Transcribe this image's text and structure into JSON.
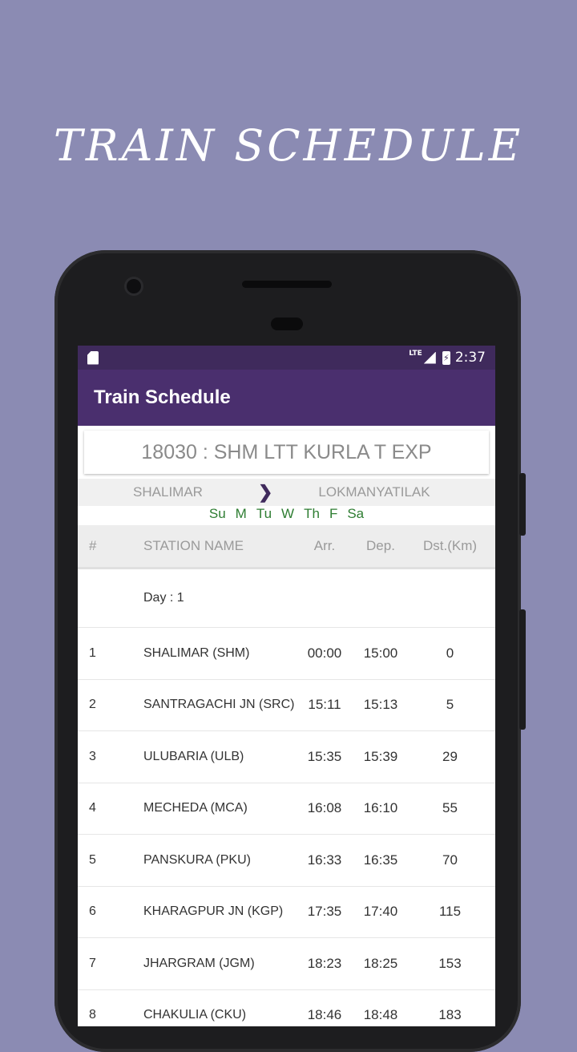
{
  "promo": {
    "title": "TRAIN SCHEDULE"
  },
  "status_bar": {
    "lte": "LTE",
    "time": "2:37"
  },
  "app_bar": {
    "title": "Train Schedule"
  },
  "train": {
    "name": "18030 : SHM LTT KURLA T EXP",
    "from": "SHALIMAR",
    "to": "LOKMANYATILAK",
    "days": [
      "Su",
      "M",
      "Tu",
      "W",
      "Th",
      "F",
      "Sa"
    ]
  },
  "table": {
    "headers": {
      "num": "#",
      "station": "STATION NAME",
      "arr": "Arr.",
      "dep": "Dep.",
      "dst": "Dst.(Km)"
    },
    "day_label": "Day : 1",
    "rows": [
      {
        "num": "1",
        "station": "SHALIMAR (SHM)",
        "arr": "00:00",
        "dep": "15:00",
        "dst": "0"
      },
      {
        "num": "2",
        "station": "SANTRAGACHI JN (SRC)",
        "arr": "15:11",
        "dep": "15:13",
        "dst": "5"
      },
      {
        "num": "3",
        "station": "ULUBARIA (ULB)",
        "arr": "15:35",
        "dep": "15:39",
        "dst": "29"
      },
      {
        "num": "4",
        "station": "MECHEDA (MCA)",
        "arr": "16:08",
        "dep": "16:10",
        "dst": "55"
      },
      {
        "num": "5",
        "station": "PANSKURA (PKU)",
        "arr": "16:33",
        "dep": "16:35",
        "dst": "70"
      },
      {
        "num": "6",
        "station": "KHARAGPUR JN (KGP)",
        "arr": "17:35",
        "dep": "17:40",
        "dst": "115"
      },
      {
        "num": "7",
        "station": "JHARGRAM (JGM)",
        "arr": "18:23",
        "dep": "18:25",
        "dst": "153"
      },
      {
        "num": "8",
        "station": "CHAKULIA (CKU)",
        "arr": "18:46",
        "dep": "18:48",
        "dst": "183"
      }
    ]
  },
  "colors": {
    "background": "#8b8bb3",
    "app_bar": "#4a2f6e",
    "status_bar": "#3f2a5c",
    "day_text": "#2e7d32"
  }
}
